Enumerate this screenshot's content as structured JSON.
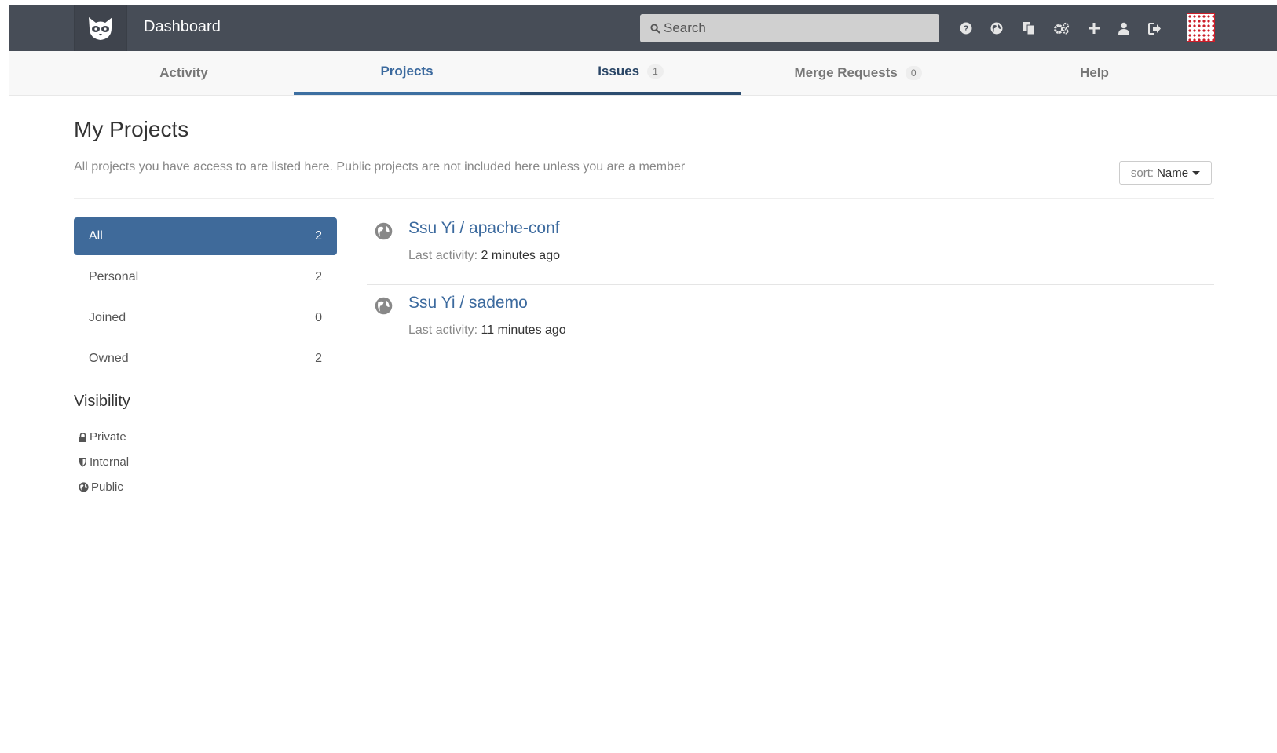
{
  "header": {
    "title": "Dashboard",
    "search_placeholder": "Search",
    "icons": [
      "help-icon",
      "explore-globe-icon",
      "snippets-icon",
      "admin-icon",
      "new-project-icon",
      "profile-icon",
      "logout-icon"
    ]
  },
  "nav": {
    "tabs": [
      {
        "label": "Activity"
      },
      {
        "label": "Projects",
        "active": true
      },
      {
        "label": "Issues",
        "count": "1"
      },
      {
        "label": "Merge Requests",
        "count": "0"
      },
      {
        "label": "Help"
      }
    ]
  },
  "main": {
    "title": "My Projects",
    "description": "All projects you have access to are listed here. Public projects are not included here unless you are a member",
    "sort": {
      "label": "sort:",
      "value": "Name"
    }
  },
  "filters": [
    {
      "label": "All",
      "count": "2",
      "active": true
    },
    {
      "label": "Personal",
      "count": "2"
    },
    {
      "label": "Joined",
      "count": "0"
    },
    {
      "label": "Owned",
      "count": "2"
    }
  ],
  "visibility": {
    "title": "Visibility",
    "items": [
      {
        "label": "Private",
        "icon": "lock-icon"
      },
      {
        "label": "Internal",
        "icon": "shield-icon"
      },
      {
        "label": "Public",
        "icon": "globe-icon"
      }
    ]
  },
  "projects": [
    {
      "name": "Ssu Yi / apache-conf",
      "activity_label": "Last activity:",
      "activity_time": "2 minutes ago"
    },
    {
      "name": "Ssu Yi / sademo",
      "activity_label": "Last activity:",
      "activity_time": "11 minutes ago"
    }
  ],
  "colors": {
    "header_bg": "#474d57",
    "accent": "#3f6a9a",
    "link": "#3c6a9e"
  }
}
